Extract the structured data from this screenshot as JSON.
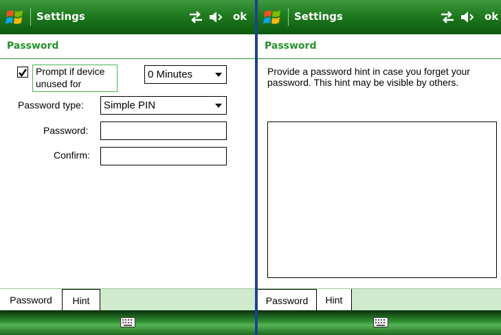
{
  "screens": [
    {
      "title": "Settings",
      "ok_label": "ok",
      "subheader": "Password",
      "prompt_checkbox": {
        "label_line1": "Prompt if device",
        "label_line2": "unused for",
        "checked": true
      },
      "timeout_dropdown": {
        "value": "0 Minutes"
      },
      "password_type": {
        "label": "Password type:",
        "value": "Simple PIN"
      },
      "password_field": {
        "label": "Password:",
        "value": ""
      },
      "confirm_field": {
        "label": "Confirm:",
        "value": ""
      },
      "tabs": [
        {
          "label": "Password",
          "active": true
        },
        {
          "label": "Hint",
          "active": false
        }
      ]
    },
    {
      "title": "Settings",
      "ok_label": "ok",
      "subheader": "Password",
      "hint_instructions": "Provide a password hint in case you forget your password.  This hint may be visible by others.",
      "hint_value": "",
      "tabs": [
        {
          "label": "Password",
          "active": false
        },
        {
          "label": "Hint",
          "active": true
        }
      ]
    }
  ],
  "icons": {
    "start": "windows-flag-icon",
    "connectivity": "connectivity-icon",
    "volume": "volume-icon",
    "keyboard": "keyboard-icon"
  },
  "colors": {
    "title_bar": "#1f7a1f",
    "subheader_text": "#25922c",
    "tab_strip": "#cfeacc",
    "divider": "#1d3f9e"
  }
}
